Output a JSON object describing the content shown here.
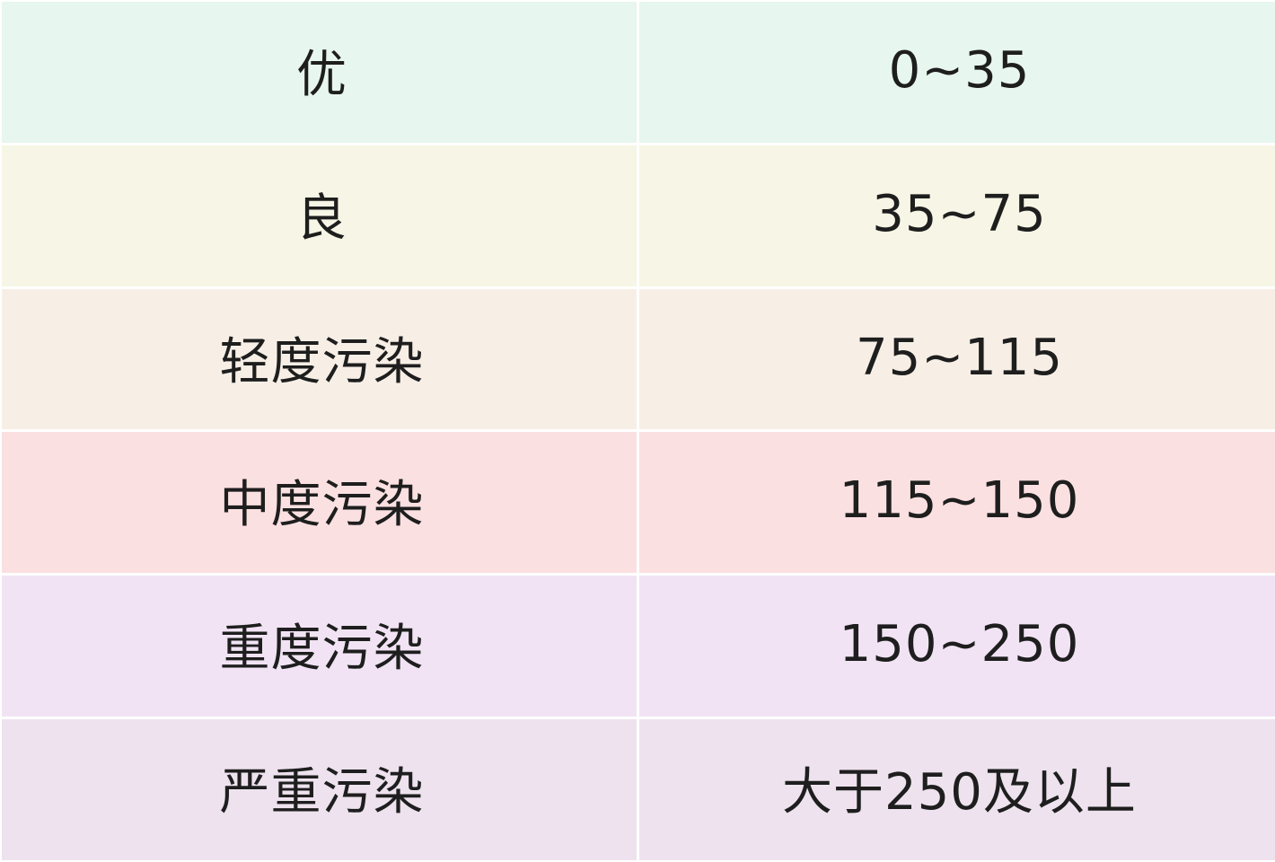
{
  "table": {
    "rows": [
      {
        "level": "优",
        "range": "0~35",
        "color": "#e7f6ee"
      },
      {
        "level": "良",
        "range": "35~75",
        "color": "#f7f5e5"
      },
      {
        "level": "轻度污染",
        "range": "75~115",
        "color": "#f7efe6"
      },
      {
        "level": "中度污染",
        "range": "115~150",
        "color": "#fbe0e1"
      },
      {
        "level": "重度污染",
        "range": "150~250",
        "color": "#f1e3f4"
      },
      {
        "level": "严重污染",
        "range": "大于250及以上",
        "color": "#ede2ee"
      }
    ]
  }
}
